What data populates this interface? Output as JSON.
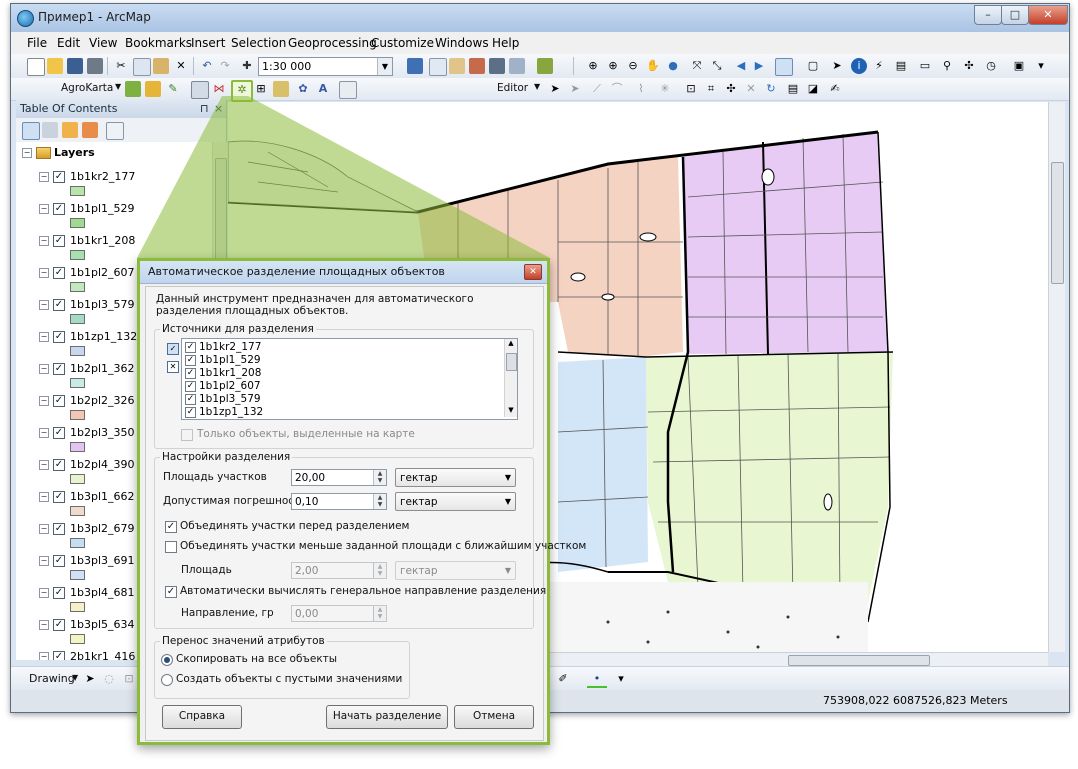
{
  "window": {
    "title": "Пример1 - ArcMap",
    "minimize": "–",
    "maximize": "□",
    "close": "✕"
  },
  "menu": [
    "File",
    "Edit",
    "View",
    "Bookmarks",
    "Insert",
    "Selection",
    "Geoprocessing",
    "Customize",
    "Windows",
    "Help"
  ],
  "toolbar": {
    "scale": "1:30 000",
    "agrokarta_label": "AgroKarta",
    "editor_label": "Editor"
  },
  "toc": {
    "title": "Table Of Contents",
    "pin": "⊓",
    "close": "×",
    "root_label": "Layers",
    "layers": [
      {
        "name": "1b1kr2_177",
        "color": "#b7e4a8"
      },
      {
        "name": "1b1pl1_529",
        "color": "#9edb8e"
      },
      {
        "name": "1b1kr1_208",
        "color": "#a6e0b0"
      },
      {
        "name": "1b1pl2_607",
        "color": "#c2e8c0"
      },
      {
        "name": "1b1pl3_579",
        "color": "#a3dcc2"
      },
      {
        "name": "1b1zp1_132",
        "color": "#c9d6f0"
      },
      {
        "name": "1b2pl1_362",
        "color": "#c8ebe8"
      },
      {
        "name": "1b2pl2_326",
        "color": "#f3c6b4"
      },
      {
        "name": "1b2pl3_350",
        "color": "#e2c3f1"
      },
      {
        "name": "1b2pl4_390",
        "color": "#e7f5cf"
      },
      {
        "name": "1b3pl1_662",
        "color": "#efdacd"
      },
      {
        "name": "1b3pl2_679",
        "color": "#c6def2"
      },
      {
        "name": "1b3pl3_691",
        "color": "#cfe0f7"
      },
      {
        "name": "1b3pl4_681",
        "color": "#f5f0c8"
      },
      {
        "name": "1b3pl5_634",
        "color": "#f4f3c2"
      },
      {
        "name": "2b1kr1_416",
        "color": "#e9efb4"
      }
    ]
  },
  "bottom_toolbar": {
    "drawing_label": "Drawing"
  },
  "status": {
    "coordinates": "753908,022  6087526,823 Meters"
  },
  "dialog": {
    "title": "Автоматическое разделение площадных объектов",
    "description": "Данный инструмент предназначен для автоматического разделения площадных объектов.",
    "sources_group": "Источники для разделения",
    "sources": [
      "1b1kr2_177",
      "1b1pl1_529",
      "1b1kr1_208",
      "1b1pl2_607",
      "1b1pl3_579",
      "1b1zp1_132"
    ],
    "only_selected": "Только объекты, выделенные на карте",
    "settings_group": "Настройки разделения",
    "area_label": "Площадь участков",
    "area_value": "20,00",
    "area_unit": "гектар",
    "tolerance_label": "Допустимая погрешность",
    "tolerance_value": "0,10",
    "tolerance_unit": "гектар",
    "merge_before": "Объединять участки перед разделением",
    "merge_small": "Объединять участки меньше заданной площади с ближайшим участком",
    "small_area_label": "Площадь",
    "small_area_value": "2,00",
    "small_area_unit": "гектар",
    "auto_direction": "Автоматически вычислять генеральное направление разделения",
    "direction_label": "Направление, гр",
    "direction_value": "0,00",
    "attr_group": "Перенос значений атрибутов",
    "copy_all": "Скопировать на все объекты",
    "create_empty": "Создать объекты с пустыми значениями",
    "help_button": "Справка",
    "start_button": "Начать разделение",
    "cancel_button": "Отмена"
  },
  "colors": {
    "callout_green": "#8cbb3a",
    "parcel_pink": "#f5d3c3",
    "parcel_purple": "#e8cbf4",
    "parcel_green": "#e8f6d2",
    "parcel_blue": "#d3e6f8",
    "parcel_yellow": "#f8f5cc"
  }
}
